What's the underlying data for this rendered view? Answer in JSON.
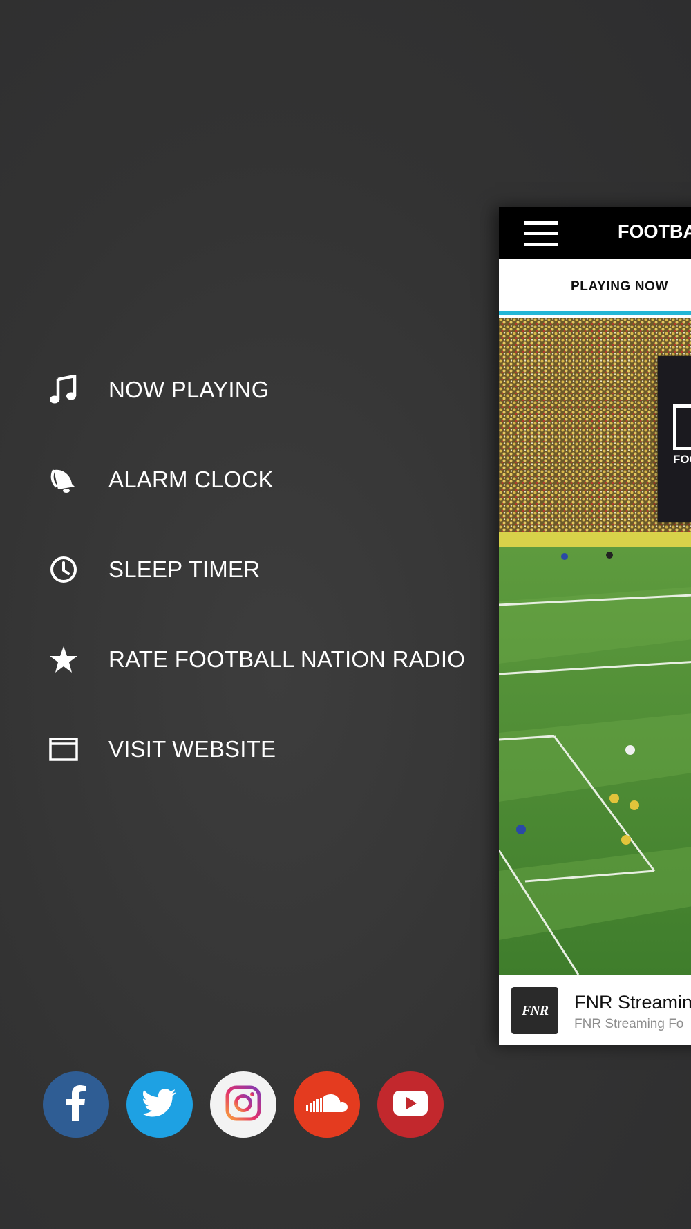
{
  "menu": {
    "items": [
      {
        "label": "NOW PLAYING",
        "icon": "music-note-icon"
      },
      {
        "label": "ALARM CLOCK",
        "icon": "bell-icon"
      },
      {
        "label": "SLEEP TIMER",
        "icon": "clock-icon"
      },
      {
        "label": "RATE FOOTBALL NATION RADIO",
        "icon": "star-icon"
      },
      {
        "label": "VISIT WEBSITE",
        "icon": "browser-window-icon"
      }
    ]
  },
  "social": [
    {
      "network": "Facebook",
      "icon": "facebook-icon",
      "color": "#2f5d94"
    },
    {
      "network": "Twitter",
      "icon": "twitter-icon",
      "color": "#1ea1e3"
    },
    {
      "network": "Instagram",
      "icon": "instagram-icon",
      "color": "#f3f3f3"
    },
    {
      "network": "SoundCloud",
      "icon": "soundcloud-icon",
      "color": "#e43b1f"
    },
    {
      "network": "YouTube",
      "icon": "youtube-icon",
      "color": "#c2282d"
    }
  ],
  "app_panel": {
    "title": "FOOTBA",
    "tab_label": "PLAYING NOW",
    "accent_color": "#23b6d6",
    "station_logo_text": "FOO",
    "player": {
      "thumb_text": "FNR",
      "title": "FNR Streamin",
      "subtitle": "FNR Streaming Fo"
    }
  }
}
